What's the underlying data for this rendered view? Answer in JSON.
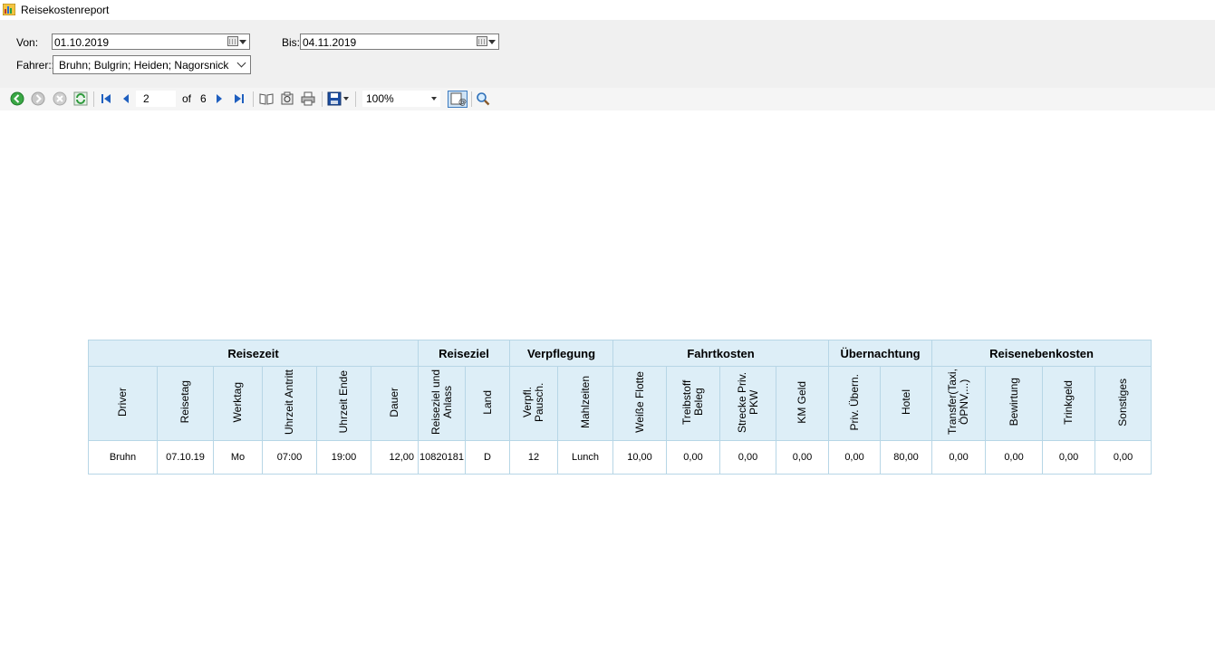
{
  "window": {
    "title": "Reisekostenreport"
  },
  "filters": {
    "von_label": "Von:",
    "von_value": "01.10.2019",
    "bis_label": "Bis:",
    "bis_value": "04.11.2019",
    "fahrer_label": "Fahrer::",
    "fahrer_value": "Bruhn; Bulgrin; Heiden; Nagorsnick"
  },
  "toolbar": {
    "current_page": "2",
    "of_label": "of",
    "total_pages": "6",
    "zoom": "100%"
  },
  "report": {
    "groups": [
      {
        "label": "Reisezeit"
      },
      {
        "label": "Reiseziel"
      },
      {
        "label": "Verpflegung"
      },
      {
        "label": "Fahrtkosten"
      },
      {
        "label": "Übernachtung"
      },
      {
        "label": "Reisenebenkosten"
      }
    ],
    "columns": [
      "Driver",
      "Reisetag",
      "Werktag",
      "Uhrzeit Antritt",
      "Uhrzeit Ende",
      "Dauer",
      "Reiseziel und Anlass",
      "Land",
      "Verpfl. Pausch.",
      "Mahlzeiten",
      "Weiße Flotte",
      "Treibstoff Beleg",
      "Strecke Priv. PKW",
      "KM Geld",
      "Priv. Übern.",
      "Hotel",
      "Transfer(Taxi, ÖPNV,...)",
      "Bewirtung",
      "Trinkgeld",
      "Sonstiges"
    ],
    "rows": [
      [
        "Bruhn",
        "07.10.19",
        "Mo",
        "07:00",
        "19:00",
        "12,00",
        "10820181",
        "D",
        "12",
        "Lunch",
        "10,00",
        "0,00",
        "0,00",
        "0,00",
        "0,00",
        "80,00",
        "0,00",
        "0,00",
        "0,00",
        "0,00"
      ]
    ]
  }
}
